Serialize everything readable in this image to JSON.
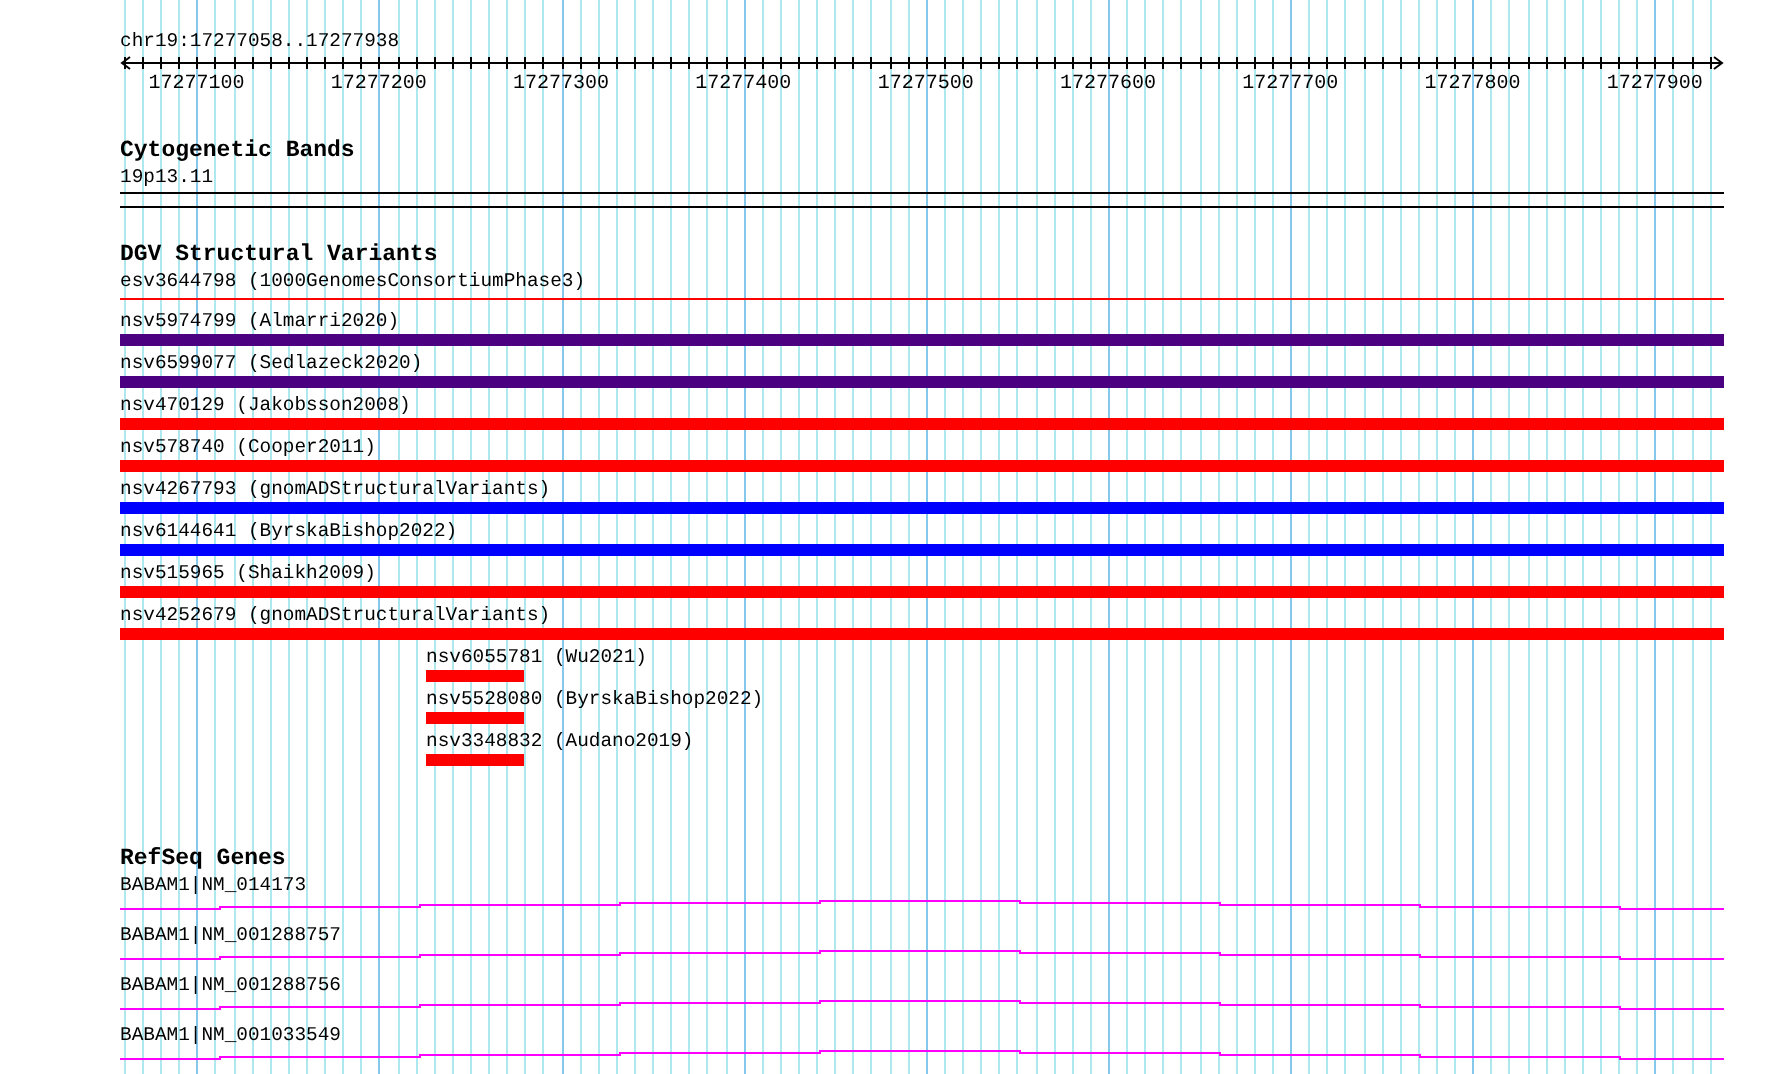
{
  "ruler": {
    "location": "chr19:17277058..17277938",
    "ticks": [
      "17277100",
      "17277200",
      "17277300",
      "17277400",
      "17277500",
      "17277600",
      "17277700",
      "17277800",
      "17277900"
    ]
  },
  "tracks": [
    {
      "kind": "bands",
      "title": "Cytogenetic Bands",
      "features": [
        {
          "label": "19p13.11"
        }
      ]
    },
    {
      "kind": "variants",
      "title": "DGV Structural Variants",
      "features": [
        {
          "label": "esv3644798 (1000GenomesConsortiumPhase3)",
          "kind": "line",
          "inset": false,
          "color": "#ff0000"
        },
        {
          "label": "nsv5974799 (Almarri2020)",
          "kind": "bar",
          "inset": false,
          "color": "#4b0082"
        },
        {
          "label": "nsv6599077 (Sedlazeck2020)",
          "kind": "bar",
          "inset": false,
          "color": "#4b0082"
        },
        {
          "label": "nsv470129 (Jakobsson2008)",
          "kind": "bar",
          "inset": false,
          "color": "#ff0000"
        },
        {
          "label": "nsv578740 (Cooper2011)",
          "kind": "bar",
          "inset": false,
          "color": "#ff0000"
        },
        {
          "label": "nsv4267793 (gnomADStructuralVariants)",
          "kind": "bar",
          "inset": false,
          "color": "#0000ff"
        },
        {
          "label": "nsv6144641 (ByrskaBishop2022)",
          "kind": "bar",
          "inset": false,
          "color": "#0000ff"
        },
        {
          "label": "nsv515965 (Shaikh2009)",
          "kind": "bar",
          "inset": false,
          "color": "#ff0000"
        },
        {
          "label": "nsv4252679 (gnomADStructuralVariants)",
          "kind": "bar",
          "inset": false,
          "color": "#ff0000"
        },
        {
          "label": "nsv6055781 (Wu2021)",
          "kind": "bar",
          "inset": true,
          "color": "#ff0000"
        },
        {
          "label": "nsv5528080 (ByrskaBishop2022)",
          "kind": "bar",
          "inset": true,
          "color": "#ff0000"
        },
        {
          "label": "nsv3348832 (Audano2019)",
          "kind": "bar",
          "inset": true,
          "color": "#ff0000"
        }
      ]
    },
    {
      "kind": "genes",
      "title": "RefSeq Genes",
      "features": [
        {
          "label": "BABAM1|NM_014173"
        },
        {
          "label": "BABAM1|NM_001288757"
        },
        {
          "label": "BABAM1|NM_001288756"
        },
        {
          "label": "BABAM1|NM_001033549"
        }
      ]
    }
  ]
}
